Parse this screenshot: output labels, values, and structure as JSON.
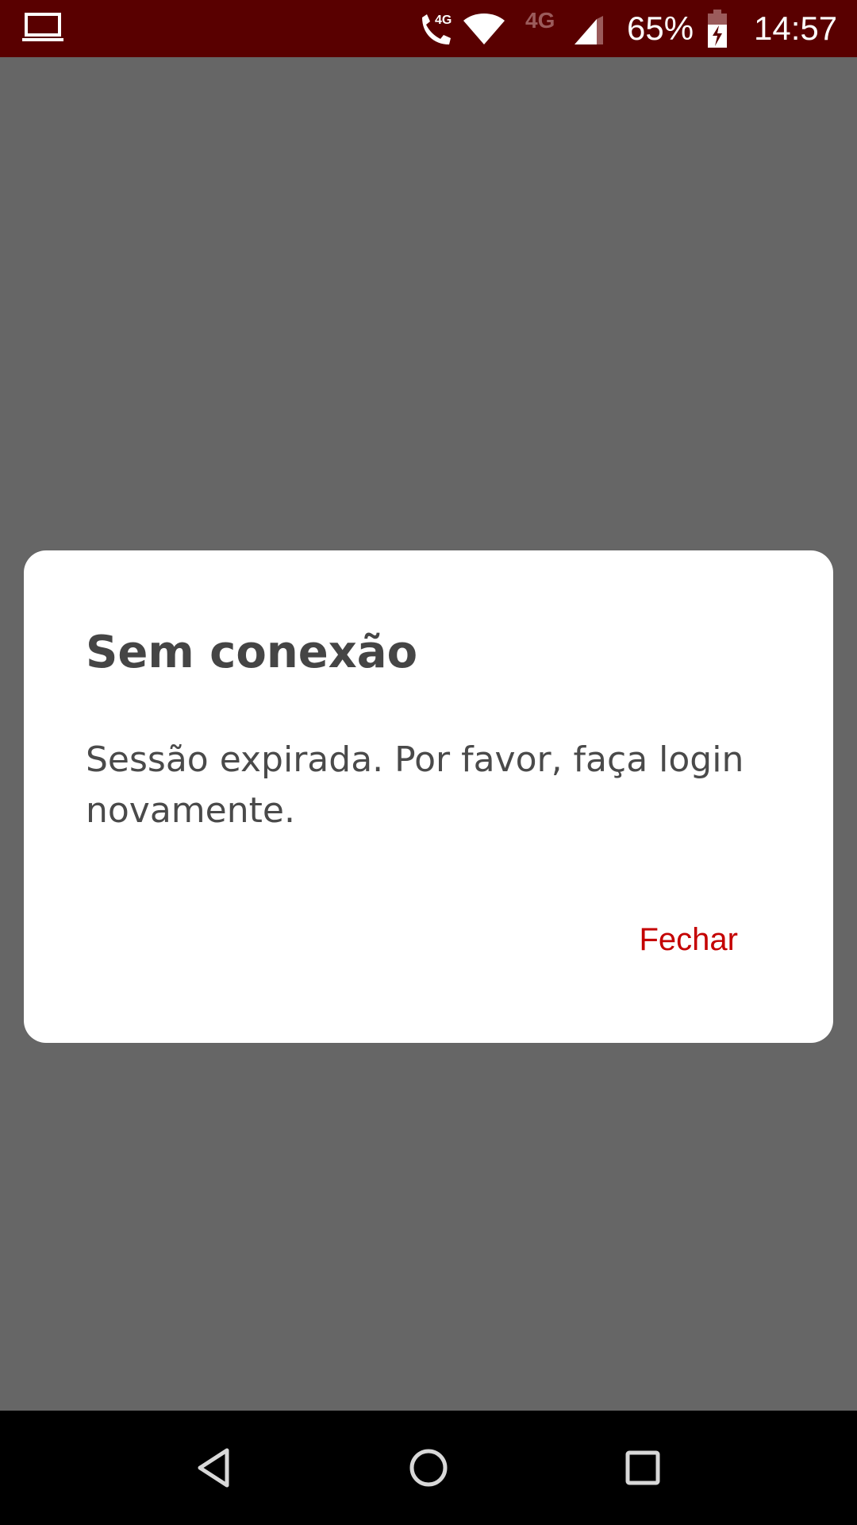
{
  "status_bar": {
    "network_label": "4G",
    "secondary_network_label": "4G",
    "battery_percent": "65%",
    "time": "14:57",
    "background_color": "#590000",
    "icons": [
      "laptop-icon",
      "wifi-call-icon",
      "wifi-icon",
      "signal-icon",
      "battery-charging-icon"
    ]
  },
  "dialog": {
    "title": "Sem conexão",
    "message": "Sessão expirada. Por favor, faça login novamente.",
    "close_label": "Fechar",
    "accent_color": "#c40000"
  },
  "nav_bar": {
    "icons": [
      "back-icon",
      "home-icon",
      "recents-icon"
    ]
  },
  "scrim_color": "#666666"
}
